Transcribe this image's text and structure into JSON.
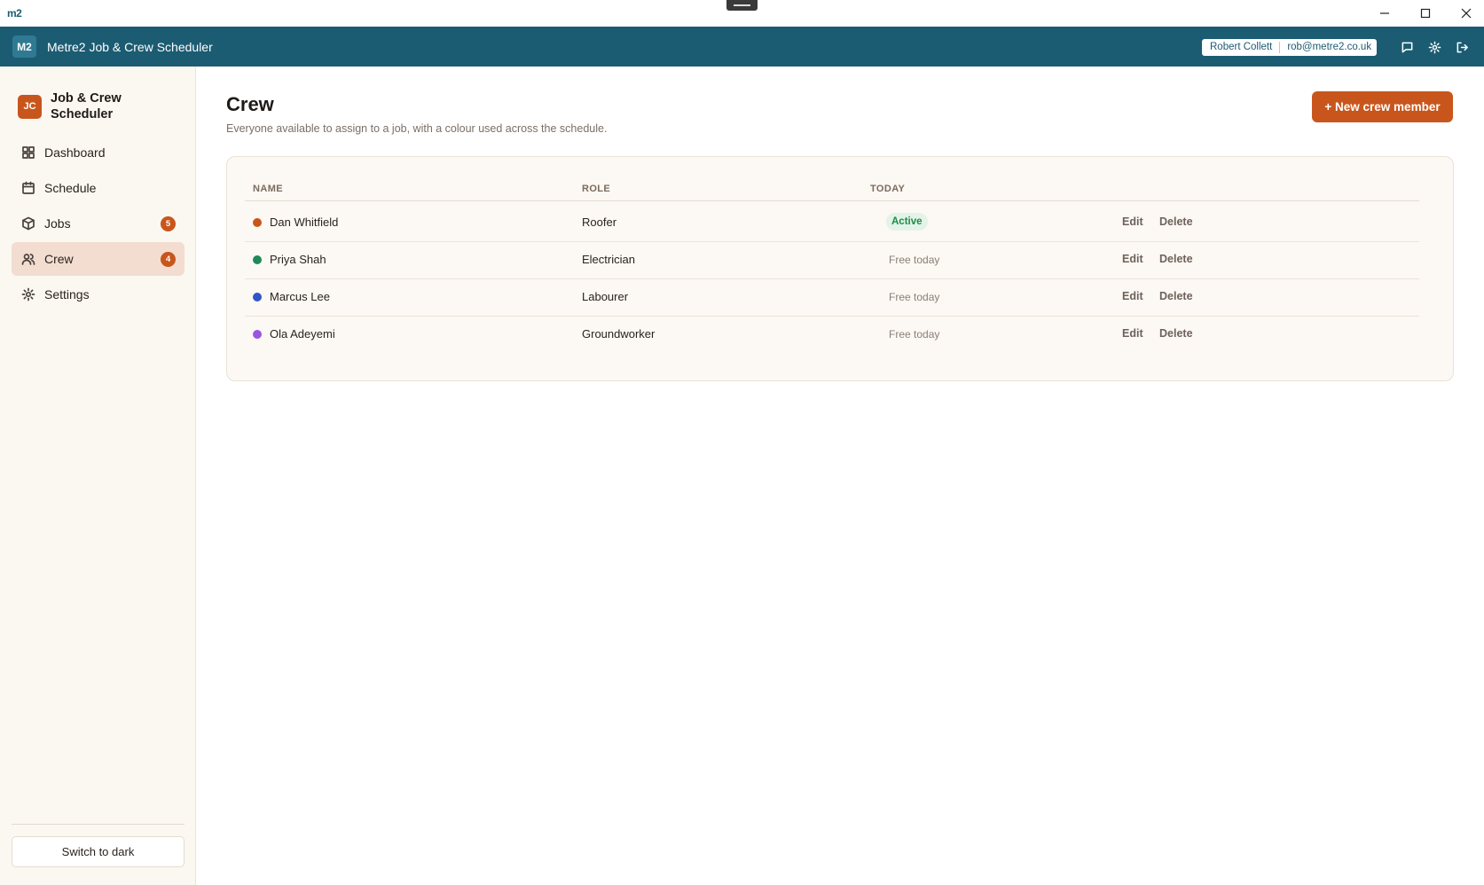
{
  "window": {
    "logo_text": "m2",
    "controls": [
      "minimize-icon",
      "maximize-icon",
      "close-icon"
    ]
  },
  "header": {
    "logo": "M2",
    "title": "Metre2 Job & Crew Scheduler",
    "user_name": "Robert Collett",
    "user_email": "rob@metre2.co.uk",
    "icons": [
      "message-icon",
      "settings-icon",
      "logout-icon"
    ],
    "background": "#1b5c72"
  },
  "sidebar": {
    "brand_badge": "JC",
    "brand_name": "Job & Crew Scheduler",
    "items": [
      {
        "label": "Dashboard",
        "icon": "grid-icon",
        "count": null,
        "active": false
      },
      {
        "label": "Schedule",
        "icon": "calendar-icon",
        "count": null,
        "active": false
      },
      {
        "label": "Jobs",
        "icon": "box-icon",
        "count": "5",
        "active": false
      },
      {
        "label": "Crew",
        "icon": "users-icon",
        "count": "4",
        "active": true
      },
      {
        "label": "Settings",
        "icon": "gear-icon",
        "count": null,
        "active": false
      }
    ],
    "theme_toggle": "Switch to dark"
  },
  "main": {
    "title": "Crew",
    "subtitle": "Everyone available to assign to a job, with a colour used across the schedule.",
    "new_button": "+ New crew member",
    "accent": "#c8561c",
    "table": {
      "headers": {
        "name": "NAME",
        "role": "ROLE",
        "today": "TODAY"
      },
      "edit_label": "Edit",
      "delete_label": "Delete",
      "rows": [
        {
          "name": "Dan Whitfield",
          "role": "Roofer",
          "today": "Active",
          "status": "active",
          "color": "#c8561c"
        },
        {
          "name": "Priya Shah",
          "role": "Electrician",
          "today": "Free today",
          "status": "free",
          "color": "#1e8a57"
        },
        {
          "name": "Marcus Lee",
          "role": "Labourer",
          "today": "Free today",
          "status": "free",
          "color": "#2f55c9"
        },
        {
          "name": "Ola Adeyemi",
          "role": "Groundworker",
          "today": "Free today",
          "status": "free",
          "color": "#9a56e0"
        }
      ]
    }
  }
}
